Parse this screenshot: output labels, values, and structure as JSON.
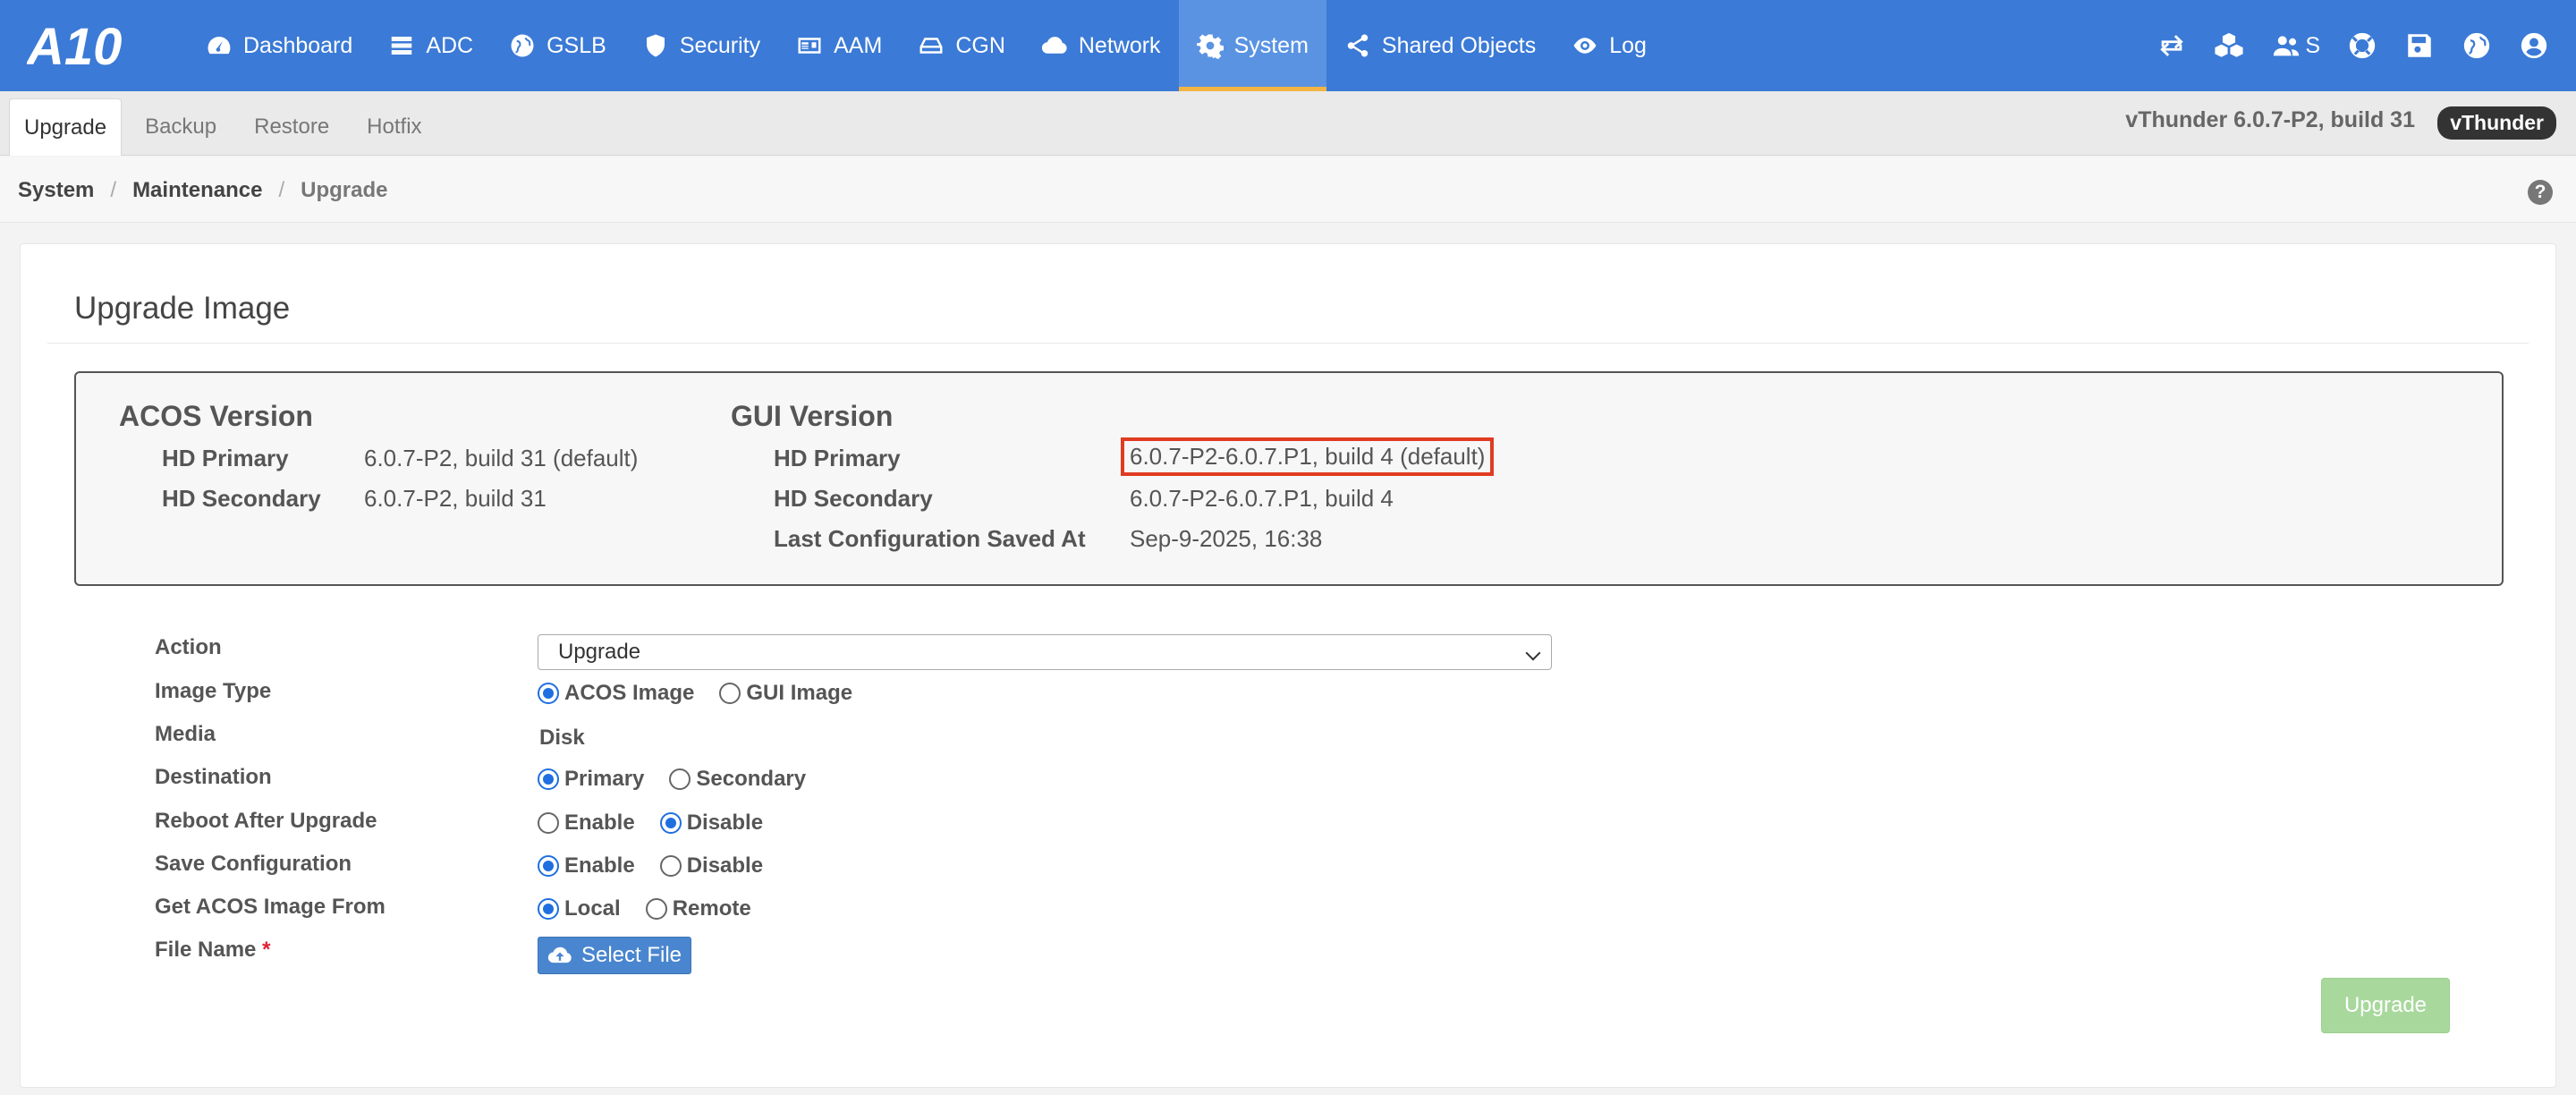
{
  "nav": {
    "logo": "A10",
    "items": [
      {
        "label": "Dashboard",
        "icon": "dashboard-icon"
      },
      {
        "label": "ADC",
        "icon": "server-icon"
      },
      {
        "label": "GSLB",
        "icon": "globe-icon"
      },
      {
        "label": "Security",
        "icon": "shield-icon"
      },
      {
        "label": "AAM",
        "icon": "id-card-icon"
      },
      {
        "label": "CGN",
        "icon": "drive-icon"
      },
      {
        "label": "Network",
        "icon": "cloud-icon"
      },
      {
        "label": "System",
        "icon": "gear-icon"
      },
      {
        "label": "Shared Objects",
        "icon": "share-icon"
      },
      {
        "label": "Log",
        "icon": "eye-icon"
      }
    ],
    "active": "System",
    "user_initial": "S"
  },
  "subnav": {
    "tabs": [
      "Upgrade",
      "Backup",
      "Restore",
      "Hotfix"
    ],
    "active": "Upgrade",
    "version": "vThunder 6.0.7-P2, build 31",
    "badge": "vThunder"
  },
  "breadcrumb": [
    "System",
    "Maintenance",
    "Upgrade"
  ],
  "page": {
    "title": "Upgrade Image",
    "acos": {
      "heading": "ACOS Version",
      "hd_primary_label": "HD Primary",
      "hd_primary": "6.0.7-P2, build 31 (default)",
      "hd_secondary_label": "HD Secondary",
      "hd_secondary": "6.0.7-P2, build 31"
    },
    "gui": {
      "heading": "GUI Version",
      "hd_primary_label": "HD Primary",
      "hd_primary": "6.0.7-P2-6.0.7.P1, build 4 (default)",
      "hd_secondary_label": "HD Secondary",
      "hd_secondary": "6.0.7-P2-6.0.7.P1, build 4",
      "last_saved_label": "Last Configuration Saved At",
      "last_saved": "Sep-9-2025, 16:38"
    }
  },
  "form": {
    "action_label": "Action",
    "action_value": "Upgrade",
    "image_type_label": "Image Type",
    "image_type_options": [
      "ACOS Image",
      "GUI Image"
    ],
    "media_label": "Media",
    "media_value": "Disk",
    "destination_label": "Destination",
    "destination_options": [
      "Primary",
      "Secondary"
    ],
    "reboot_label": "Reboot After Upgrade",
    "reboot_options": [
      "Enable",
      "Disable"
    ],
    "save_label": "Save Configuration",
    "save_options": [
      "Enable",
      "Disable"
    ],
    "source_label": "Get ACOS Image From",
    "source_options": [
      "Local",
      "Remote"
    ],
    "file_label": "File Name",
    "required_mark": "*",
    "select_file": "Select File",
    "submit": "Upgrade"
  },
  "colors": {
    "nav_bg": "#3b7ad6",
    "active_underline": "#f2b544",
    "highlight_box": "#e03c22",
    "radio": "#1f6fe0",
    "upgrade_button": "#a8d89c"
  }
}
